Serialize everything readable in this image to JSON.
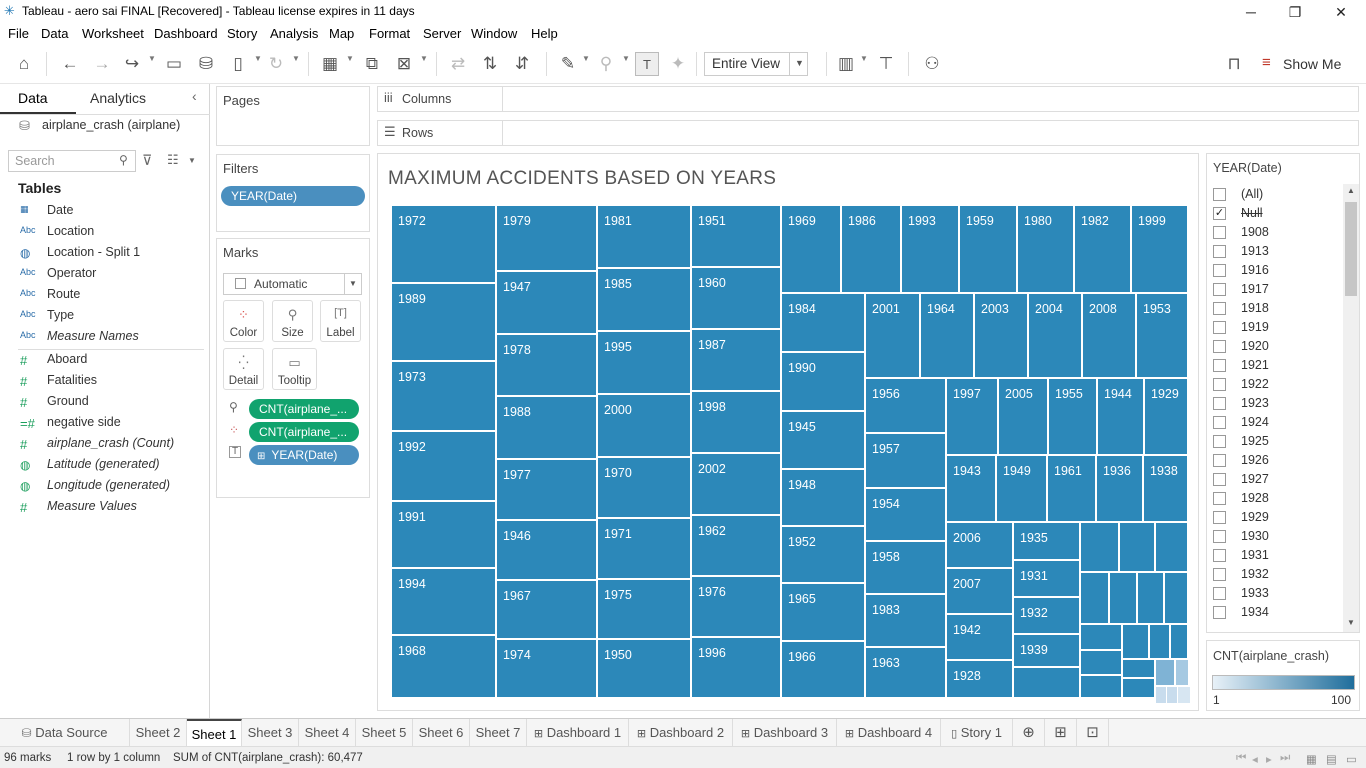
{
  "window": {
    "title": "Tableau - aero sai FINAL [Recovered] - Tableau license expires in 11 days"
  },
  "menu": [
    "File",
    "Data",
    "Worksheet",
    "Dashboard",
    "Story",
    "Analysis",
    "Map",
    "Format",
    "Server",
    "Window",
    "Help"
  ],
  "toolbar": {
    "view_mode": "Entire View",
    "show_me": "Show Me"
  },
  "data_pane": {
    "tabs": [
      "Data",
      "Analytics"
    ],
    "datasource": "airplane_crash (airplane)",
    "search_placeholder": "Search",
    "tables_header": "Tables",
    "fields": [
      {
        "name": "Date",
        "kind": "date"
      },
      {
        "name": "Location",
        "kind": "abc"
      },
      {
        "name": "Location - Split 1",
        "kind": "geo"
      },
      {
        "name": "Operator",
        "kind": "abc"
      },
      {
        "name": "Route",
        "kind": "abc"
      },
      {
        "name": "Type",
        "kind": "abc"
      },
      {
        "name": "Measure Names",
        "kind": "abc"
      },
      {
        "name": "Aboard",
        "kind": "measure"
      },
      {
        "name": "Fatalities",
        "kind": "measure"
      },
      {
        "name": "Ground",
        "kind": "measure"
      },
      {
        "name": "negative side",
        "kind": "measure"
      },
      {
        "name": "airplane_crash (Count)",
        "kind": "measure"
      },
      {
        "name": "Latitude (generated)",
        "kind": "geo"
      },
      {
        "name": "Longitude (generated)",
        "kind": "geo"
      },
      {
        "name": "Measure Values",
        "kind": "measure"
      }
    ]
  },
  "cards": {
    "pages": "Pages",
    "filters": "Filters",
    "filter_pill": "YEAR(Date)",
    "marks": "Marks",
    "mark_type": "Automatic",
    "mark_buttons": [
      "Color",
      "Size",
      "Label",
      "Detail",
      "Tooltip"
    ],
    "mark_pills": [
      "CNT(airplane_...",
      "CNT(airplane_...",
      "YEAR(Date)"
    ]
  },
  "shelves": {
    "columns": "Columns",
    "rows": "Rows"
  },
  "viz": {
    "title": "MAXIMUM ACCIDENTS BASED ON YEARS",
    "cells": [
      "1972",
      "1989",
      "1973",
      "1992",
      "1991",
      "1994",
      "1968",
      "1979",
      "1947",
      "1978",
      "1988",
      "1977",
      "1946",
      "1967",
      "1974",
      "1981",
      "1985",
      "1995",
      "2000",
      "1970",
      "1971",
      "1975",
      "1950",
      "1951",
      "1960",
      "1987",
      "1998",
      "2002",
      "1962",
      "1976",
      "1996",
      "1969",
      "1986",
      "1993",
      "1959",
      "1980",
      "1982",
      "1999",
      "1984",
      "2001",
      "1964",
      "2003",
      "2004",
      "2008",
      "1953",
      "1990",
      "1945",
      "1948",
      "1952",
      "1965",
      "1966",
      "1956",
      "1957",
      "1954",
      "1958",
      "1983",
      "1963",
      "1997",
      "2005",
      "1955",
      "1944",
      "1929",
      "1943",
      "1949",
      "1961",
      "1936",
      "1938",
      "2006",
      "1935",
      "2007",
      "1931",
      "1932",
      "1942",
      "1939",
      "1928"
    ]
  },
  "year_filter": {
    "title": "YEAR(Date)",
    "items": [
      {
        "label": "(All)",
        "checked": false
      },
      {
        "label": "Null",
        "checked": true
      },
      {
        "label": "1908",
        "checked": false
      },
      {
        "label": "1913",
        "checked": false
      },
      {
        "label": "1916",
        "checked": false
      },
      {
        "label": "1917",
        "checked": false
      },
      {
        "label": "1918",
        "checked": false
      },
      {
        "label": "1919",
        "checked": false
      },
      {
        "label": "1920",
        "checked": false
      },
      {
        "label": "1921",
        "checked": false
      },
      {
        "label": "1922",
        "checked": false
      },
      {
        "label": "1923",
        "checked": false
      },
      {
        "label": "1924",
        "checked": false
      },
      {
        "label": "1925",
        "checked": false
      },
      {
        "label": "1926",
        "checked": false
      },
      {
        "label": "1927",
        "checked": false
      },
      {
        "label": "1928",
        "checked": false
      },
      {
        "label": "1929",
        "checked": false
      },
      {
        "label": "1930",
        "checked": false
      },
      {
        "label": "1931",
        "checked": false
      },
      {
        "label": "1932",
        "checked": false
      },
      {
        "label": "1933",
        "checked": false
      },
      {
        "label": "1934",
        "checked": false
      }
    ]
  },
  "legend": {
    "title": "CNT(airplane_crash)",
    "min": "1",
    "max": "100",
    "color_low": "#e8f1f8",
    "color_high": "#1f6e9c"
  },
  "tabs": [
    "Data Source",
    "Sheet 2",
    "Sheet 1",
    "Sheet 3",
    "Sheet 4",
    "Sheet 5",
    "Sheet 6",
    "Sheet 7",
    "Dashboard 1",
    "Dashboard 2",
    "Dashboard 3",
    "Dashboard 4",
    "Story 1"
  ],
  "active_tab": "Sheet 1",
  "status": {
    "marks": "96 marks",
    "layout": "1 row by 1 column",
    "sum": "SUM of CNT(airplane_crash): 60,477"
  }
}
